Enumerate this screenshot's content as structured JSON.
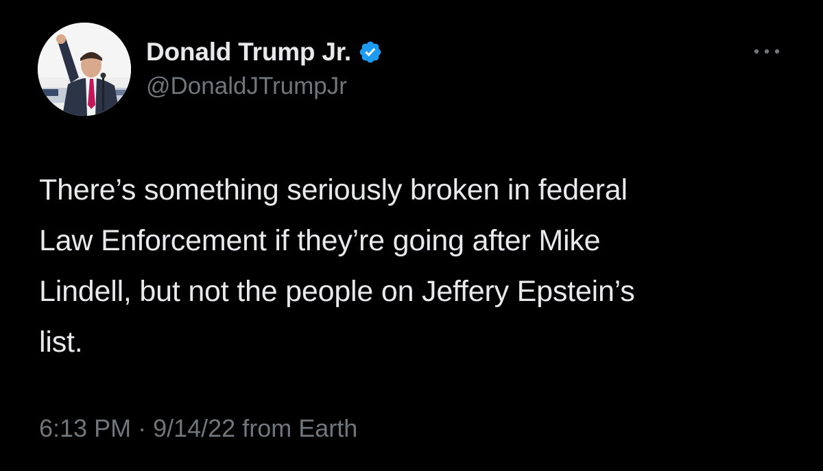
{
  "author": {
    "display_name": "Donald Trump Jr.",
    "handle": "@DonaldJTrumpJr",
    "verified": true,
    "avatar_icon": "profile-photo"
  },
  "tweet": {
    "text": "There’s something seriously broken in federal\nLaw Enforcement if they’re going after Mike\nLindell, but not the people on Jeffery Epstein’s\nlist.",
    "time": "6:13 PM",
    "separator": "·",
    "date": "9/14/22",
    "source_prefix": "from",
    "source": "Earth"
  },
  "icons": {
    "more": "more-options-icon",
    "verified": "verified-badge-icon"
  },
  "colors": {
    "background": "#000000",
    "primary_text": "#e7e9ea",
    "secondary_text": "#71767b",
    "verified_blue": "#1d9bf0"
  }
}
